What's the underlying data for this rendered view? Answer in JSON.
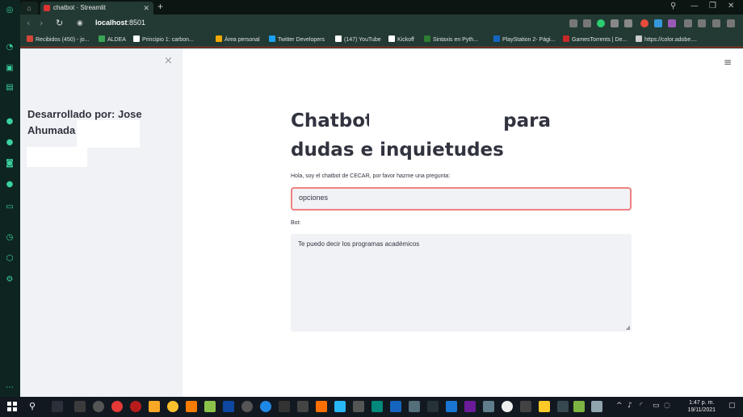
{
  "browser": {
    "tab_title": "chatbot · Streamlit",
    "new_tab": "+",
    "url_host": "localhost",
    "url_port": ":8501",
    "nav": {
      "back": "‹",
      "forward": "›",
      "reload": "↻"
    },
    "window": {
      "minimize": "—",
      "restore": "❐",
      "close": "✕"
    }
  },
  "bookmarks": [
    {
      "label": "Recibidos (450) - jo...",
      "color": "#d44638"
    },
    {
      "label": "ALDEA",
      "color": "#3aa655"
    },
    {
      "label": "Principio 1: carbon...",
      "color": "#ffffff"
    },
    {
      "label": "Área personal",
      "color": "#f2a900"
    },
    {
      "label": "Twitter Developers",
      "color": "#1da1f2"
    },
    {
      "label": "(147) YouTube",
      "color": "#ffffff"
    },
    {
      "label": "Kickoff",
      "color": "#ffffff"
    },
    {
      "label": "Sintaxis en Pyth...",
      "color": "#2e7d32"
    },
    {
      "label": "PlayStation 2- Pági...",
      "color": "#1565c0"
    },
    {
      "label": "GamesTorrents | De...",
      "color": "#c62828"
    },
    {
      "label": "https://color.adobe....",
      "color": "#cccccc"
    }
  ],
  "streamlit": {
    "sidebar_close": "×",
    "sidebar_text": "Desarrollado por: Jose Ahumada",
    "menu_icon": "≡",
    "title": "Chatbot                    para dudas e inquietudes",
    "prompt_label": "Hola, soy el chatbot de CECAR, por favor hazme una pregunta:",
    "input_value": "opciones",
    "bot_label": "Bot:",
    "bot_response": "Te puedo decir los programas académicos"
  },
  "taskbar": {
    "time": "1:47 p. m.",
    "date": "19/11/2021"
  },
  "colors": {
    "accent_red": "#f08080",
    "sidebar_bg": "#f0f2f6",
    "browser_dark": "#223a33"
  }
}
